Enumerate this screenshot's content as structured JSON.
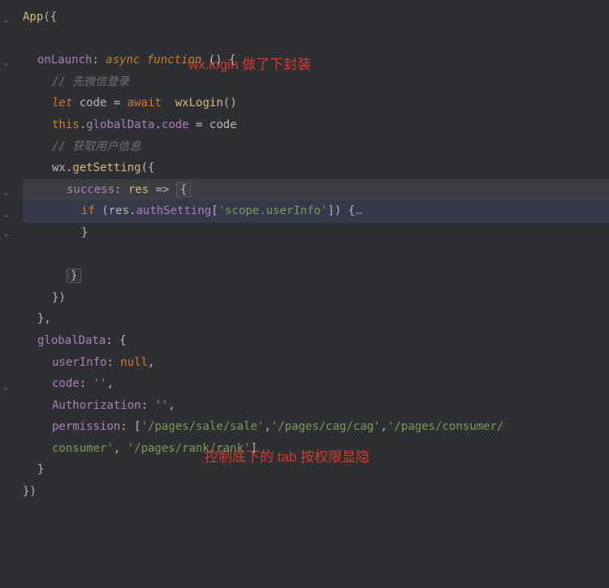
{
  "annotations": {
    "a1": "wx.login 做了下封装",
    "a2": "控制底下的 tab 按权限显隐"
  },
  "code": {
    "l0": {
      "fn": "App",
      "p1": "({"
    },
    "l1": {},
    "l2": {
      "prop": "onLaunch",
      "colon": ": ",
      "kw1": "async ",
      "kw2": "function ",
      "p2": "() {"
    },
    "l3": {
      "cmt": "// 先微信登录"
    },
    "l4": {
      "kw": "let ",
      "var": "code",
      "eq": " = ",
      "await": "await  ",
      "fn": "wxLogin",
      "p": "()"
    },
    "l5": {
      "this": "this",
      "d1": ".",
      "m1": "globalData",
      "d2": ".",
      "m2": "code",
      "eq": " = ",
      "var": "code"
    },
    "l6": {
      "cmt": "// 获取用户信息"
    },
    "l7": {
      "obj": "wx",
      "d": ".",
      "fn": "getSetting",
      "p": "({"
    },
    "l8": {
      "prop": "success",
      "colon": ": ",
      "param": "res",
      "arrow": " => ",
      "brace": "{"
    },
    "l9": {
      "kw": "if ",
      "p1": "(",
      "v": "res",
      "d": ".",
      "m": "authSetting",
      "b1": "[",
      "s": "'scope.userInfo'",
      "b2": "]) {",
      "ell": "…"
    },
    "l10": {
      "brace": "}"
    },
    "l11": {},
    "l12": {
      "brace": "}"
    },
    "l13": {
      "p": "})"
    },
    "l14": {
      "p": "},"
    },
    "l15": {
      "prop": "globalData",
      "colon": ": {",
      "p": ""
    },
    "l16": {
      "prop": "userInfo",
      "colon": ": ",
      "val": "null",
      "comma": ","
    },
    "l17": {
      "prop": "code",
      "colon": ": ",
      "val": "''",
      "comma": ","
    },
    "l18": {
      "prop": "Authorization",
      "colon": ": ",
      "val": "''",
      "comma": ","
    },
    "l19": {
      "prop": "permission",
      "colon": ": [",
      "s1": "'/pages/sale/sale'",
      "c1": ",",
      "s2": "'/pages/cag/cag'",
      "c2": ",",
      "s3": "'/pages/consumer/"
    },
    "l20": {
      "s": "consumer'",
      "c": ", ",
      "s2": "'/pages/rank/rank'",
      "b": "]"
    },
    "l21": {
      "brace": "}"
    },
    "l22": {
      "p": "})"
    }
  },
  "foldMarkers": {
    "open": "⌄",
    "closed": "›"
  }
}
